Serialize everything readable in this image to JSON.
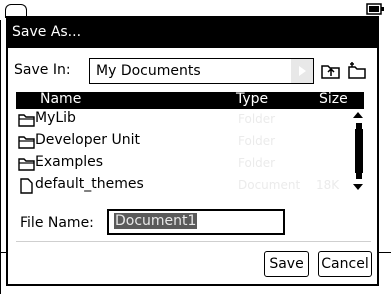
{
  "dialog": {
    "title": "Save As...",
    "save_in_label": "Save In:",
    "save_in_value": "My Documents",
    "columns": {
      "name": "Name",
      "type": "Type",
      "size": "Size"
    },
    "files": [
      {
        "name": "MyLib",
        "type": "Folder",
        "size": "",
        "icon": "folder-icon"
      },
      {
        "name": "Developer Unit",
        "type": "Folder",
        "size": "",
        "icon": "folder-icon"
      },
      {
        "name": "Examples",
        "type": "Folder",
        "size": "",
        "icon": "folder-icon"
      },
      {
        "name": "default_themes",
        "type": "Document",
        "size": "18K",
        "icon": "document-icon"
      }
    ],
    "file_name_label": "File Name:",
    "file_name_value": "Document1",
    "save_label": "Save",
    "cancel_label": "Cancel"
  }
}
